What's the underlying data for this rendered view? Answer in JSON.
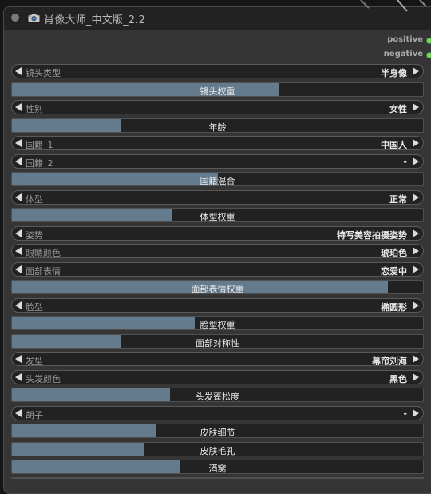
{
  "node": {
    "title": "肖像大师_中文版_2.2",
    "outputs": [
      "positive",
      "negative"
    ]
  },
  "widgets": [
    {
      "type": "combo",
      "label": "镜头类型",
      "value": "半身像"
    },
    {
      "type": "slider",
      "label": "镜头权重",
      "fill": 0.65
    },
    {
      "type": "combo",
      "label": "性别",
      "value": "女性"
    },
    {
      "type": "slider",
      "label": "年龄",
      "fill": 0.265
    },
    {
      "type": "combo",
      "label": "国籍_1",
      "value": "中国人"
    },
    {
      "type": "combo",
      "label": "国籍_2",
      "value": "-"
    },
    {
      "type": "slider",
      "label": "国籍混合",
      "fill": 0.5
    },
    {
      "type": "combo",
      "label": "体型",
      "value": "正常"
    },
    {
      "type": "slider",
      "label": "体型权重",
      "fill": 0.39
    },
    {
      "type": "combo",
      "label": "姿势",
      "value": "特写美容拍摄姿势"
    },
    {
      "type": "combo",
      "label": "眼睛颜色",
      "value": "琥珀色"
    },
    {
      "type": "combo",
      "label": "面部表情",
      "value": "恋爱中"
    },
    {
      "type": "slider",
      "label": "面部表情权重",
      "fill": 0.915
    },
    {
      "type": "combo",
      "label": "脸型",
      "value": "椭圆形"
    },
    {
      "type": "slider",
      "label": "脸型权重",
      "fill": 0.445
    },
    {
      "type": "slider",
      "label": "面部对称性",
      "fill": 0.265
    },
    {
      "type": "combo",
      "label": "发型",
      "value": "幕帘刘海"
    },
    {
      "type": "combo",
      "label": "头发颜色",
      "value": "黑色"
    },
    {
      "type": "slider",
      "label": "头发蓬松度",
      "fill": 0.385
    },
    {
      "type": "combo",
      "label": "胡子",
      "value": "-"
    },
    {
      "type": "slider",
      "label": "皮肤细节",
      "fill": 0.35
    },
    {
      "type": "slider",
      "label": "皮肤毛孔",
      "fill": 0.32
    },
    {
      "type": "slider",
      "label": "酒窝",
      "fill": 0.41
    }
  ],
  "colors": {
    "slider_fill": "#647a8d",
    "output_dot": "#7bd26b"
  },
  "icons": {
    "title": "camera-icon",
    "combo_left": "triangle-left-icon",
    "combo_right": "triangle-right-icon"
  }
}
